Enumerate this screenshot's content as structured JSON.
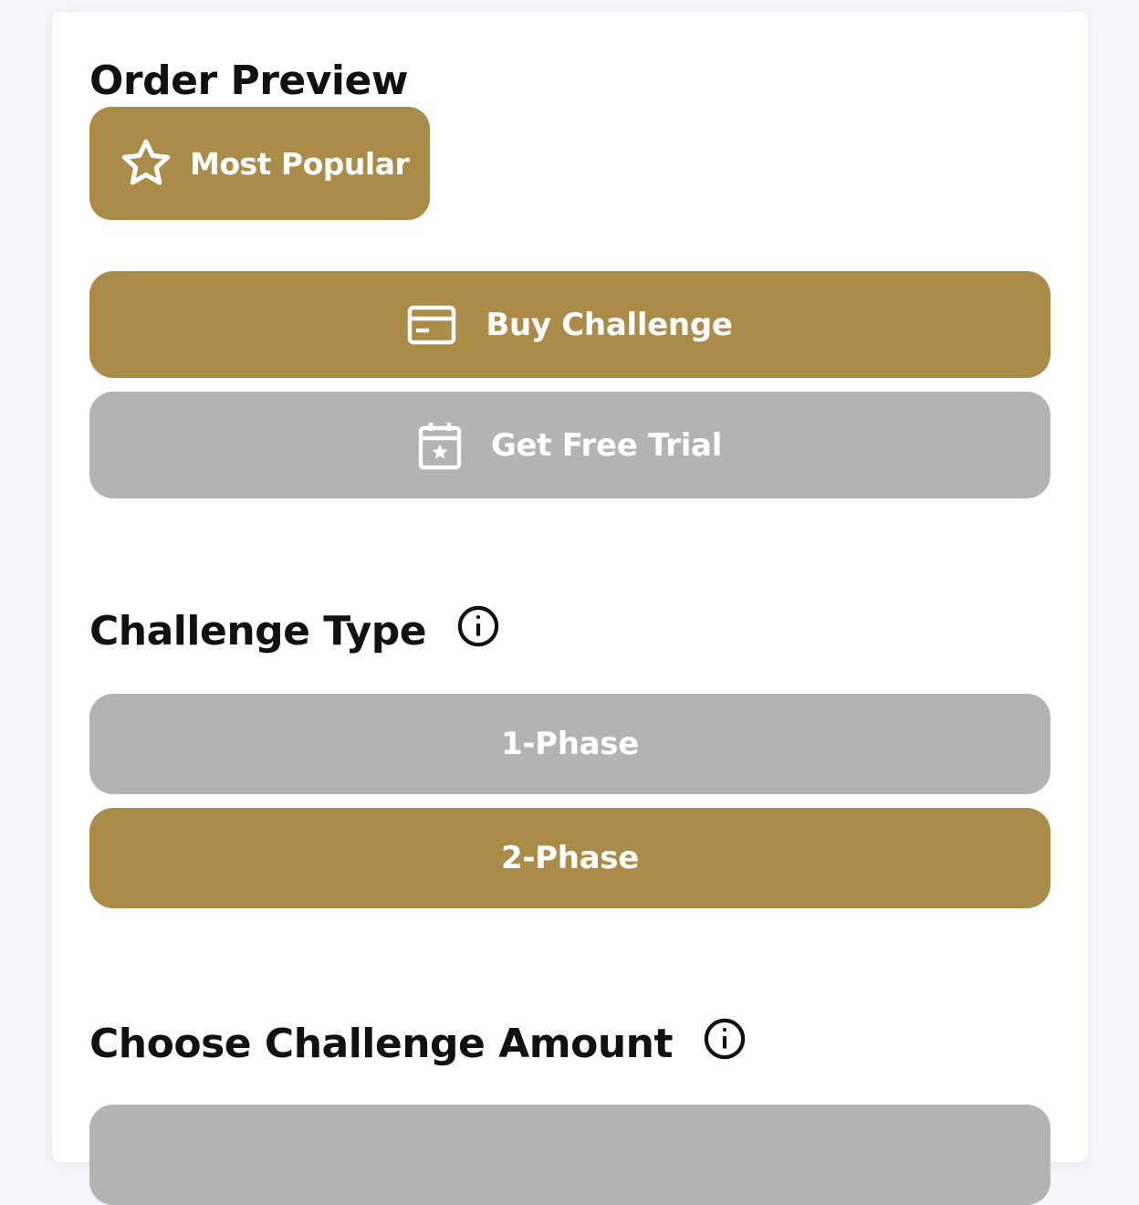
{
  "order_preview": {
    "title": "Order Preview",
    "badge": {
      "label": "Most Popular",
      "icon": "star-icon"
    },
    "buy_button": {
      "label": "Buy Challenge",
      "icon": "credit-card-icon"
    },
    "trial_button": {
      "label": "Get Free Trial",
      "icon": "calendar-star-icon"
    }
  },
  "challenge_type": {
    "title": "Challenge Type",
    "info_icon": "info-icon",
    "options": [
      {
        "label": "1-Phase",
        "selected": false
      },
      {
        "label": "2-Phase",
        "selected": true
      }
    ]
  },
  "challenge_amount": {
    "title": "Choose Challenge Amount",
    "info_icon": "info-icon"
  },
  "colors": {
    "accent": "#ab8b48",
    "inactive": "#b3b3b3",
    "background": "#f5f6fa",
    "card": "#ffffff",
    "text": "#111111"
  }
}
